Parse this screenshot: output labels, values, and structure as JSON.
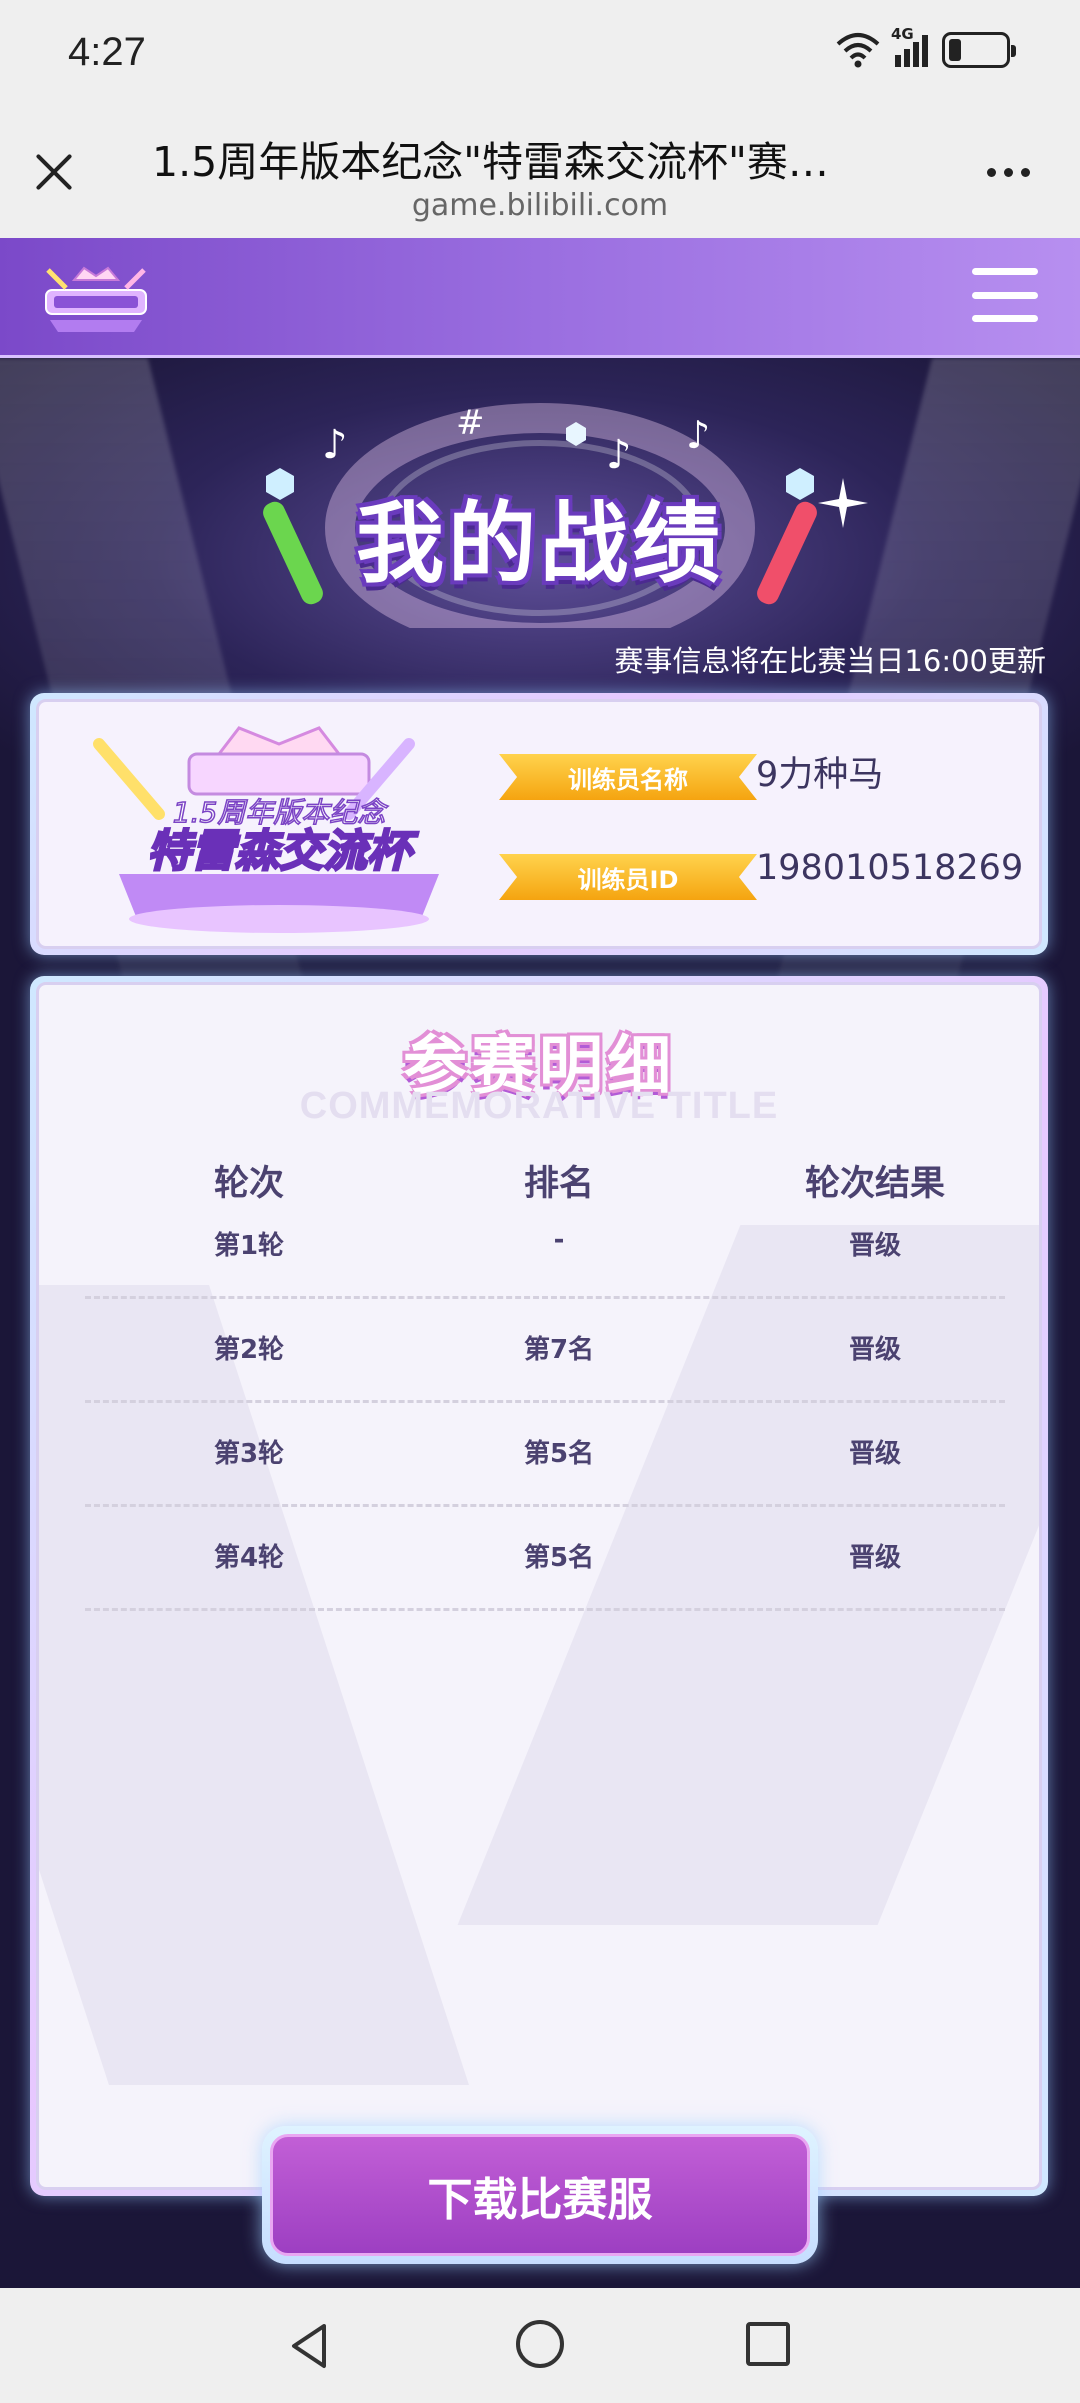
{
  "status_bar": {
    "time": "4:27",
    "network_label": "4G",
    "icons": [
      "wifi-icon",
      "signal-icon",
      "battery-icon"
    ]
  },
  "browser": {
    "title": "1.5周年版本纪念\"特雷森交流杯\"赛…",
    "url": "game.bilibili.com",
    "close_icon": "close-icon",
    "more_icon": "more-icon"
  },
  "header": {
    "menu_icon": "hamburger-icon",
    "logo_icon": "cup-logo-icon"
  },
  "hero": {
    "title": "我的战绩",
    "update_note": "赛事信息将在比赛当日16:00更新"
  },
  "profile": {
    "name_label": "训练员名称",
    "name_value": "9力种马",
    "id_label": "训练员ID",
    "id_value": "198010518269",
    "logo_line1": "1.5周年版本纪念",
    "logo_line2": "特雷森交流杯"
  },
  "detail": {
    "title": "参赛明细",
    "subtitle": "COMMEMORATIVE TITLE",
    "headers": [
      "轮次",
      "排名",
      "轮次结果"
    ],
    "rows": [
      {
        "round": "第1轮",
        "rank": "-",
        "result": "晋级"
      },
      {
        "round": "第2轮",
        "rank": "第7名",
        "result": "晋级"
      },
      {
        "round": "第3轮",
        "rank": "第5名",
        "result": "晋级"
      },
      {
        "round": "第4轮",
        "rank": "第5名",
        "result": "晋级"
      }
    ]
  },
  "download_button": "下载比赛服",
  "nav": [
    "back-icon",
    "home-icon",
    "recent-apps-icon"
  ],
  "colors": {
    "header_purple": "#7b49c9",
    "stage_dark": "#2c2458",
    "tag_gold": "#f5a410",
    "button_purple": "#9d3fc2",
    "text_purple": "#4b4270"
  }
}
